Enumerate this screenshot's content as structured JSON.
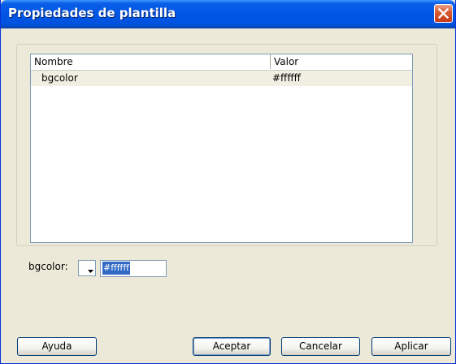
{
  "window": {
    "title": "Propiedades de plantilla"
  },
  "list": {
    "columns": [
      "Nombre",
      "Valor"
    ],
    "rows": [
      {
        "name": "bgcolor",
        "value": "#ffffff"
      }
    ]
  },
  "editor": {
    "label": "bgcolor:",
    "value": "#ffffff"
  },
  "buttons": {
    "help": "Ayuda",
    "ok": "Aceptar",
    "cancel": "Cancelar",
    "apply": "Aplicar"
  },
  "icons": {
    "close": "close-icon",
    "dropdown": "dropdown-arrow-icon"
  }
}
